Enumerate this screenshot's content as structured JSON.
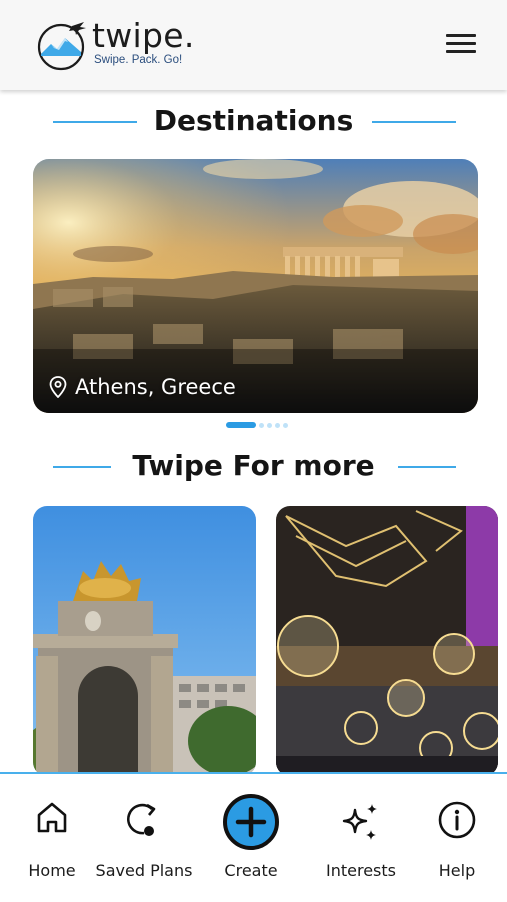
{
  "header": {
    "brand_name": "twipe.",
    "tagline": "Swipe. Pack. Go!",
    "logo_icon": "globe-plane-logo",
    "menu_icon": "hamburger-menu-icon"
  },
  "destinations": {
    "title": "Destinations",
    "card": {
      "label": "Athens, Greece",
      "icon": "location-pin-icon"
    },
    "carousel": {
      "total": 5,
      "active_index": 0
    }
  },
  "more": {
    "title": "Twipe For more"
  },
  "nav": {
    "items": [
      {
        "label": "Home",
        "icon": "home-icon"
      },
      {
        "label": "Saved Plans",
        "icon": "saved-plans-icon"
      },
      {
        "label": "Create",
        "icon": "plus-circle-icon"
      },
      {
        "label": "Interests",
        "icon": "sparkles-icon"
      },
      {
        "label": "Help",
        "icon": "info-icon"
      }
    ]
  },
  "colors": {
    "accent": "#3fa9e8",
    "create_button": "#2b9be3"
  }
}
